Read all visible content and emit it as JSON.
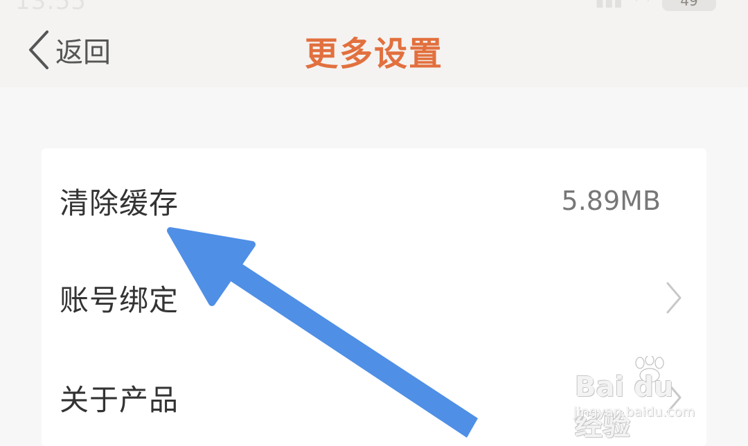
{
  "status_bar": {
    "time": "13:55",
    "battery": "49"
  },
  "header": {
    "back_label": "返回",
    "title": "更多设置"
  },
  "settings": [
    {
      "label": "清除缓存",
      "value": "5.89MB"
    },
    {
      "label": "账号绑定",
      "value": ""
    },
    {
      "label": "关于产品",
      "value": ""
    }
  ],
  "watermark": {
    "main": "Bai du 经验",
    "sub": "jingyan.baidu.com"
  },
  "colors": {
    "title": "#e2703e",
    "arrow": "#4f8fe6",
    "background": "#f7f7f7"
  },
  "icons": [
    "chevron-left-icon",
    "chevron-right-icon",
    "wifi-icon",
    "signal-icon",
    "battery-icon",
    "paw-icon"
  ]
}
